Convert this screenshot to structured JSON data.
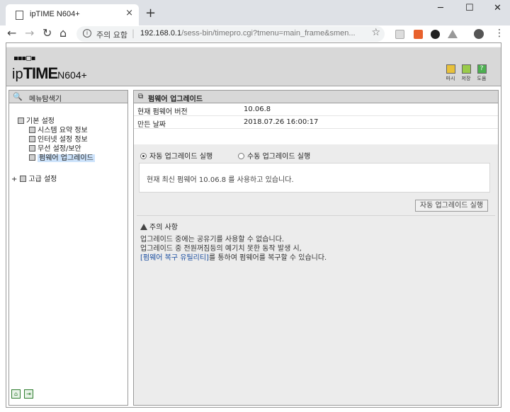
{
  "browser": {
    "tab_title": "ipTIME N604+",
    "tab_close": "×",
    "new_tab": "+",
    "win_min": "─",
    "win_max": "☐",
    "win_close": "✕",
    "back": "←",
    "forward": "→",
    "reload": "↻",
    "home": "⌂",
    "info_glyph": "i",
    "security_text": "주의 요함",
    "url_host": "192.168.0.1",
    "url_path": "/sess-bin/timepro.cgi?tmenu=main_frame&smen...",
    "star": "☆",
    "menu": "⋮"
  },
  "router": {
    "logo_grid": "▪▪▪◻▪",
    "logo_ip": "ip",
    "logo_time": "TIME",
    "logo_model": "N604+",
    "header_buttons": [
      {
        "label": "마시",
        "color": "#e8c13a"
      },
      {
        "label": "저장",
        "color": "#9acb4a"
      },
      {
        "label": "도움",
        "color": "#4caf50"
      }
    ],
    "help_glyph": "?",
    "left_title": "메뉴탐색기",
    "left_title_icon": "🔍",
    "tree": {
      "basic": "기본 설정",
      "system_summary": "시스템 요약 정보",
      "internet": "인터넷 설정 정보",
      "wireless": "무선 설정/보안",
      "firmware": "펌웨어 업그레이드",
      "advanced": "고급 설정",
      "expand": "+"
    },
    "right_title": "펌웨어 업그레이드",
    "right_title_icon": "⧉",
    "info": {
      "current_version_label": "현재 펌웨어 버전",
      "current_version": "10.06.8",
      "build_date_label": "만든 날짜",
      "build_date": "2018.07.26 16:00:17"
    },
    "auto_upgrade_radio": "자동 업그레이드 실행",
    "manual_upgrade_radio": "수동 업그레이드 실행",
    "status_message": "현재 최신 펌웨어 10.06.8 를 사용하고 있습니다.",
    "upgrade_button": "자동 업그레이드 실행",
    "caution_title": "주의 사항",
    "caution_line1": "업그레이드 중에는 공유기를 사용할 수 없습니다.",
    "caution_line2": "업그레이드 중 전원꺼짐등의 예기치 못한 동작 발생 시,",
    "caution_link": "[펌웨어 복구 유틸리티]",
    "caution_line3_rest": "를 통하여 펌웨어를 복구할 수 있습니다.",
    "footer_home": "⌂",
    "footer_exit": "⇥"
  }
}
